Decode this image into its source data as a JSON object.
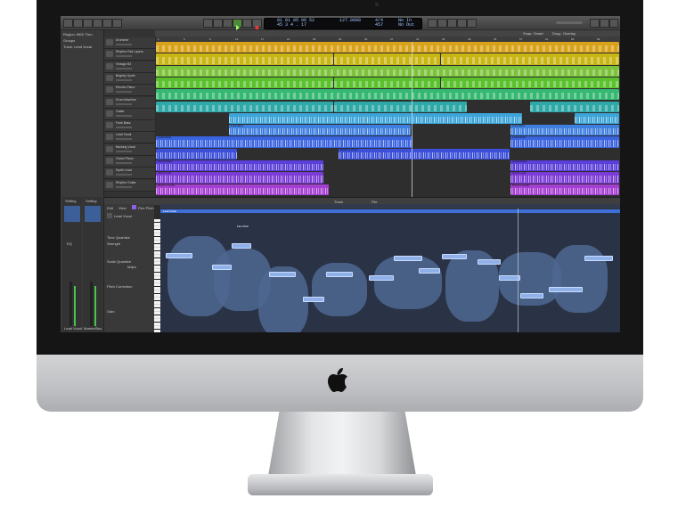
{
  "control_bar": {
    "lcd": {
      "position": "01 01 05 06 52",
      "bar_beat": "45  3  4  . 17",
      "tempo": "127.0000",
      "signature": "4/4",
      "division": "457",
      "in_label": "No In",
      "out_label": "No Out"
    }
  },
  "tracks_toolbar": {
    "edit_menu": "Edit",
    "functions_menu": "Functions",
    "view_menu": "View",
    "snap_label": "Snap:",
    "snap_value": "Smart",
    "drag_label": "Drag:",
    "drag_value": "Overlap"
  },
  "inspector": {
    "region_section": "Region: MIDI Thru",
    "groups_section": "Groups",
    "track_section": "Track: Lead Vocal"
  },
  "ruler": {
    "ticks": [
      "1",
      "5",
      "9",
      "13",
      "17",
      "21",
      "25",
      "29",
      "33",
      "37",
      "41",
      "45",
      "49",
      "53",
      "57",
      "61",
      "65",
      "69"
    ]
  },
  "tracks": [
    {
      "name": "Drummer",
      "color": "#d8a31a"
    },
    {
      "name": "Rhythm Pad Layers",
      "color": "#c9b614"
    },
    {
      "name": "Vintage B3",
      "color": "#7cc23a"
    },
    {
      "name": "Brightly Synth",
      "color": "#5bc22e"
    },
    {
      "name": "Electric Piano",
      "color": "#35b872"
    },
    {
      "name": "Drum Machine",
      "color": "#2fa9a8"
    },
    {
      "name": "Guitar",
      "color": "#3da4d8"
    },
    {
      "name": "Funk Bass",
      "color": "#3f7fe0"
    },
    {
      "name": "Lead Vocal",
      "color": "#3a63e0"
    },
    {
      "name": "Backing Vocal",
      "color": "#3b4fd8"
    },
    {
      "name": "Grand Piano",
      "color": "#5a3fd8"
    },
    {
      "name": "Synth Lead",
      "color": "#7a3bd6"
    },
    {
      "name": "Rhythm Guitar",
      "color": "#a53fd2"
    }
  ],
  "region_labels": {
    "funk_bass": "Funk Bass",
    "lead_vocal": "Lead Vocal",
    "backing_vocal": "Backing Vocal",
    "grand_piano": "Grand Piano",
    "synth_lead": "Synth Lead",
    "rhythm_guitar": "Rhythm Guitar",
    "lead_vocal_flex": "Lead Vocal: Flex Pitch"
  },
  "editor": {
    "tabs": [
      "Track",
      "File"
    ],
    "edit_menu": "Edit",
    "view_menu": "View",
    "flex_label": "Flex Pitch",
    "region_name": "Lead Vocal",
    "inspector_labels": [
      "Time Quantize",
      "Strength",
      "Scale Quantize",
      "Pitch Correction",
      "Gain"
    ],
    "major_value": "Major",
    "note_tag": "Flex Pitch"
  },
  "mixer": {
    "strip_labels": [
      "Setting",
      "Setting"
    ],
    "eq_label": "EQ",
    "strip_names": [
      "Lead Vocal",
      "Master/Bus"
    ]
  },
  "colors": {
    "accent": "#3a63e0",
    "region_yellow": "#d8a31a",
    "region_green": "#5bc22e",
    "region_blue": "#3f7fe0",
    "region_purple": "#7a3bd6"
  }
}
